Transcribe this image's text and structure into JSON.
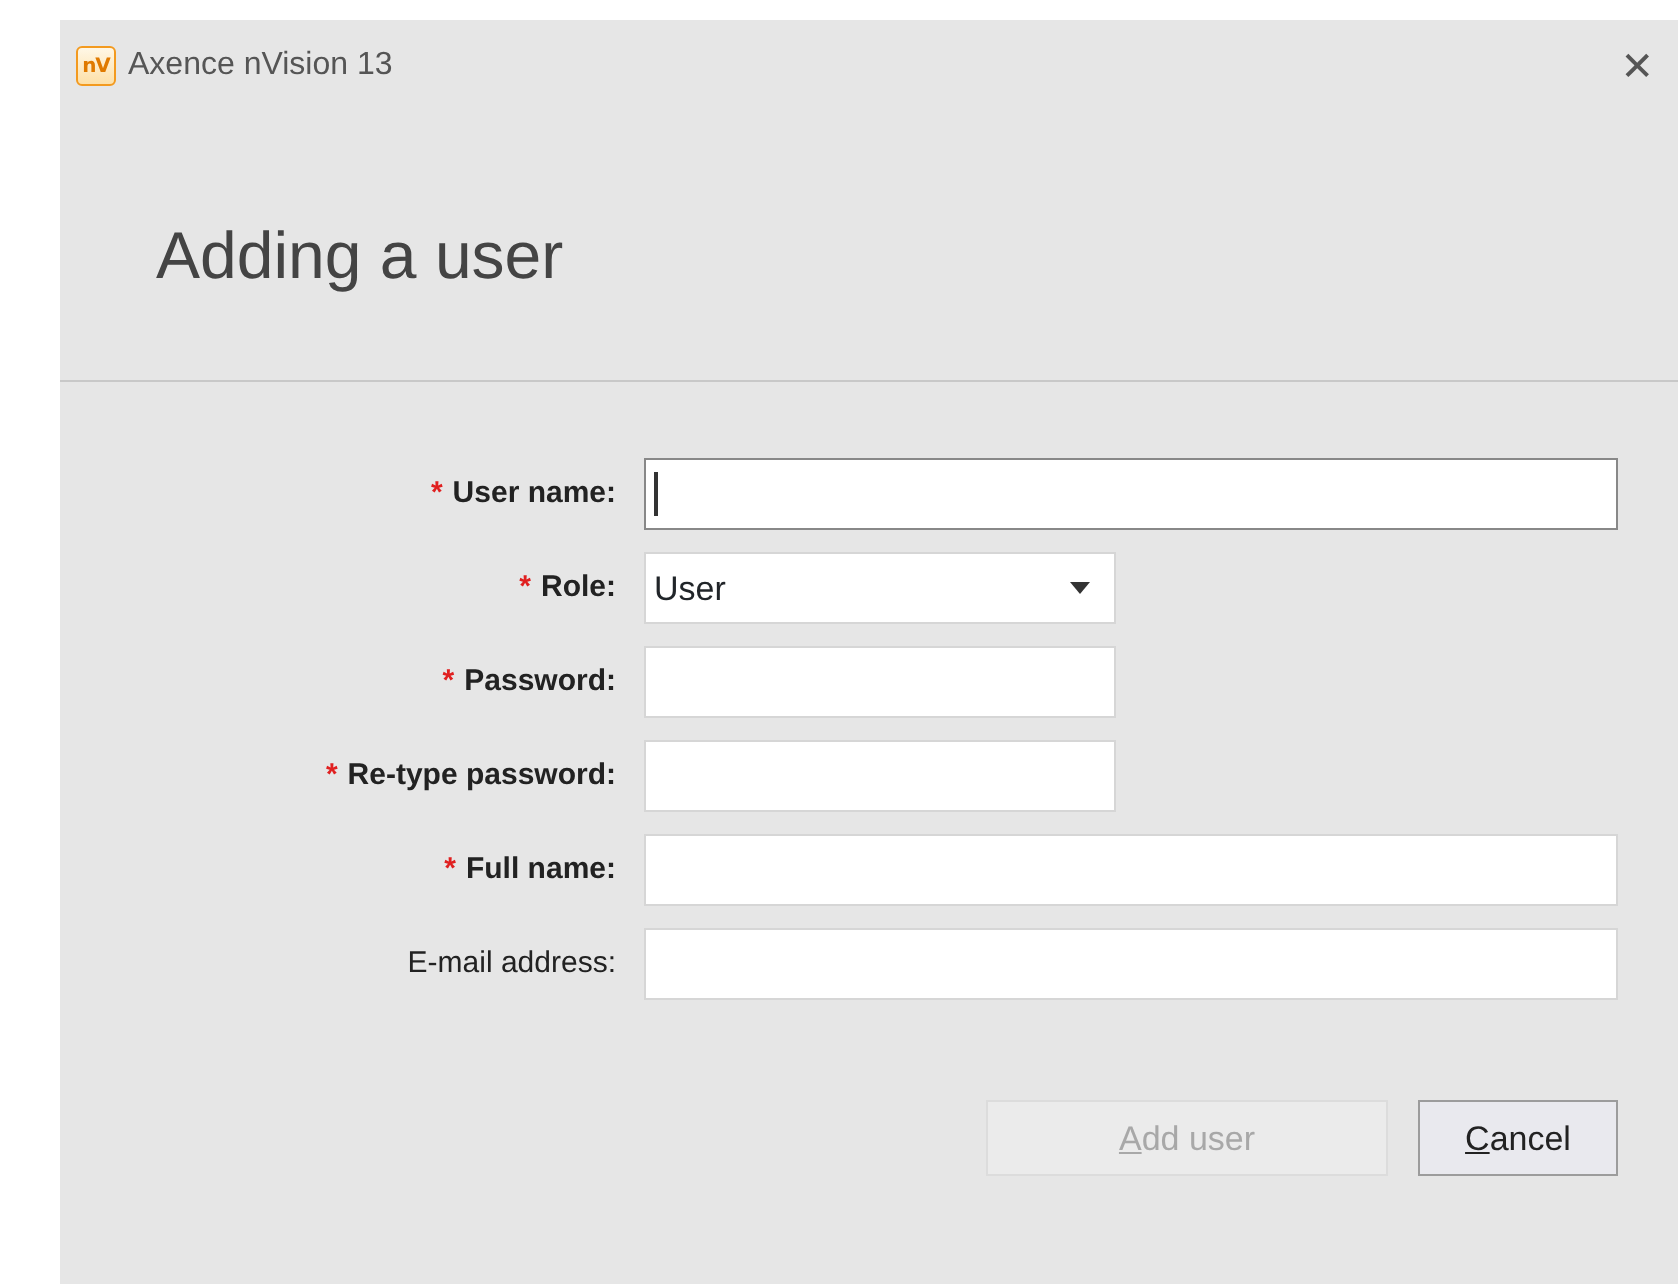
{
  "window": {
    "title": "Axence nVision 13",
    "app_icon_text": "nV",
    "close": "✕"
  },
  "heading": "Adding a user",
  "fields": [
    {
      "label": "User name:",
      "required": true,
      "kind": "text",
      "focused": true
    },
    {
      "label": "Role:",
      "required": true,
      "kind": "select",
      "value": "User",
      "focused": false
    },
    {
      "label": "Password:",
      "required": true,
      "kind": "password",
      "focused": false
    },
    {
      "label": "Re-type password:",
      "required": true,
      "kind": "password",
      "focused": false
    },
    {
      "label": "Full name:",
      "required": true,
      "kind": "text",
      "focused": false
    },
    {
      "label": "E-mail address:",
      "required": false,
      "kind": "text",
      "focused": false
    }
  ],
  "required_mark": "*",
  "buttons": [
    {
      "label": "Add user",
      "disabled": true,
      "first_letter_underlined": true
    },
    {
      "label": "Cancel",
      "disabled": false,
      "first_letter_underlined": true
    }
  ]
}
